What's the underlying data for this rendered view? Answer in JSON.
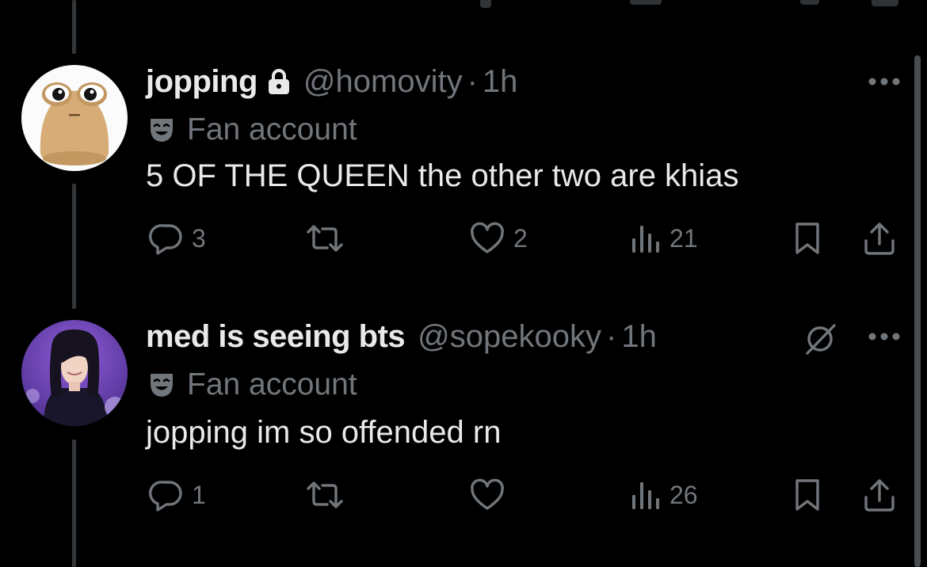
{
  "tweets": [
    {
      "display_name": "jopping",
      "handle": "@homovity",
      "separator": "·",
      "time": "1h",
      "badge": "Fan account",
      "text": "5 OF THE QUEEN the other two are khias",
      "protected": true,
      "muted_icon": false,
      "reply_count": "3",
      "retweet_count": "",
      "like_count": "2",
      "view_count": "21"
    },
    {
      "display_name": "med is seeing bts",
      "handle": "@sopekooky",
      "separator": "·",
      "time": "1h",
      "badge": "Fan account",
      "text": "jopping im so offended rn",
      "protected": false,
      "muted_icon": true,
      "reply_count": "1",
      "retweet_count": "",
      "like_count": "",
      "view_count": "26"
    }
  ],
  "icons": {
    "reply": "reply-icon",
    "retweet": "retweet-icon",
    "like": "heart-icon",
    "views": "views-icon",
    "bookmark": "bookmark-icon",
    "share": "share-icon",
    "more": "more-icon",
    "lock": "lock-icon",
    "badge": "theater-mask-icon",
    "mute": "mute-icon"
  },
  "colors": {
    "background": "#000000",
    "primary_text": "#e7e9ea",
    "secondary_text": "#71767b",
    "thread_line": "#333639"
  }
}
